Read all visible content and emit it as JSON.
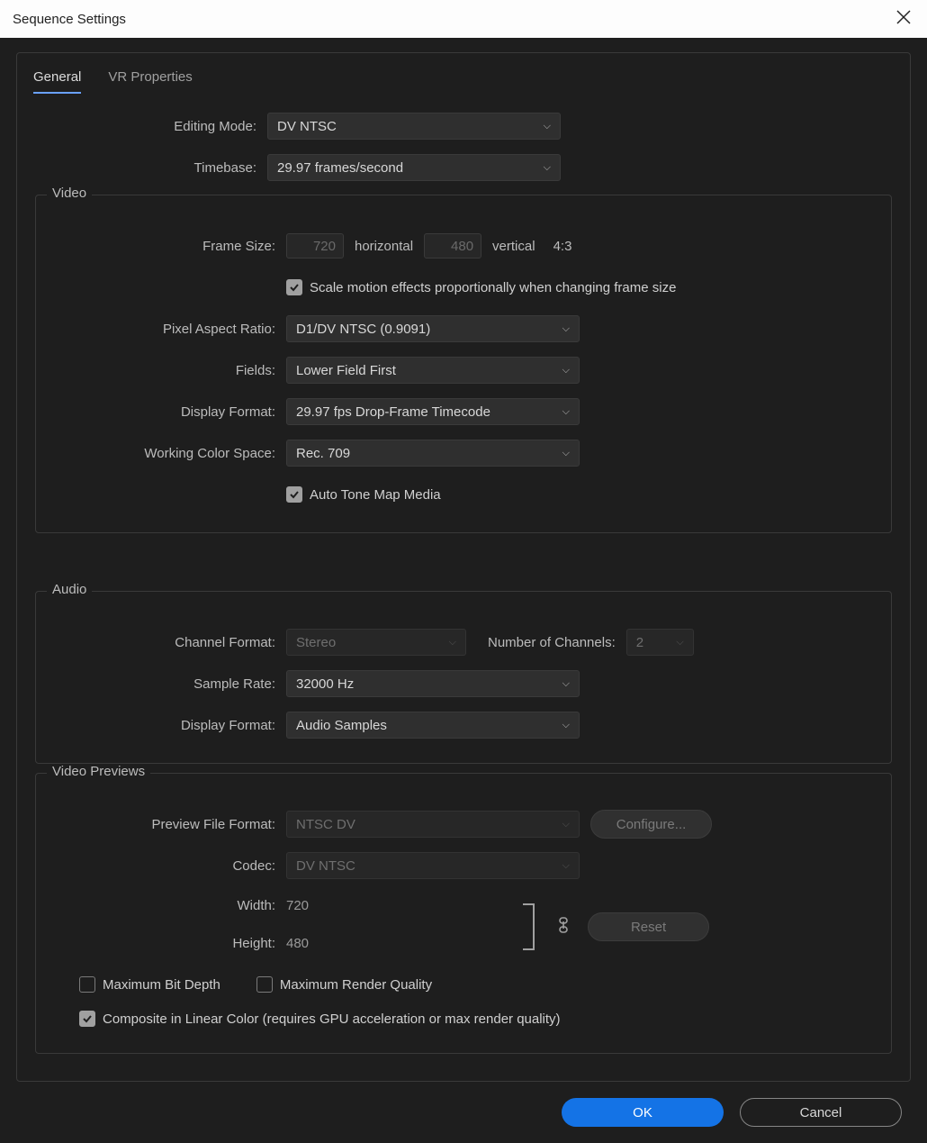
{
  "window": {
    "title": "Sequence Settings"
  },
  "tabs": {
    "general": "General",
    "vr": "VR Properties"
  },
  "general": {
    "editingMode_label": "Editing Mode:",
    "editingMode_value": "DV NTSC",
    "timebase_label": "Timebase:",
    "timebase_value": "29.97  frames/second"
  },
  "video": {
    "legend": "Video",
    "frameSize_label": "Frame Size:",
    "frameSize_w": "720",
    "horizontal": "horizontal",
    "frameSize_h": "480",
    "vertical": "vertical",
    "aspect": "4:3",
    "scaleMotion_label": "Scale motion effects proportionally when changing frame size",
    "par_label": "Pixel Aspect Ratio:",
    "par_value": "D1/DV NTSC (0.9091)",
    "fields_label": "Fields:",
    "fields_value": "Lower Field First",
    "displayFormat_label": "Display Format:",
    "displayFormat_value": "29.97 fps Drop-Frame Timecode",
    "colorSpace_label": "Working Color Space:",
    "colorSpace_value": "Rec. 709",
    "autoToneMap_label": "Auto Tone Map Media"
  },
  "audio": {
    "legend": "Audio",
    "channelFormat_label": "Channel Format:",
    "channelFormat_value": "Stereo",
    "numChannels_label": "Number of Channels:",
    "numChannels_value": "2",
    "sampleRate_label": "Sample Rate:",
    "sampleRate_value": "32000 Hz",
    "displayFormat_label": "Display Format:",
    "displayFormat_value": "Audio Samples"
  },
  "previews": {
    "legend": "Video Previews",
    "fileFormat_label": "Preview File Format:",
    "fileFormat_value": "NTSC DV",
    "configure_label": "Configure...",
    "codec_label": "Codec:",
    "codec_value": "DV NTSC",
    "width_label": "Width:",
    "width_value": "720",
    "height_label": "Height:",
    "height_value": "480",
    "reset_label": "Reset",
    "maxBitDepth_label": "Maximum Bit Depth",
    "maxRenderQuality_label": "Maximum Render Quality",
    "compositeLinear_label": "Composite in Linear Color (requires GPU acceleration or max render quality)"
  },
  "footer": {
    "ok": "OK",
    "cancel": "Cancel"
  }
}
